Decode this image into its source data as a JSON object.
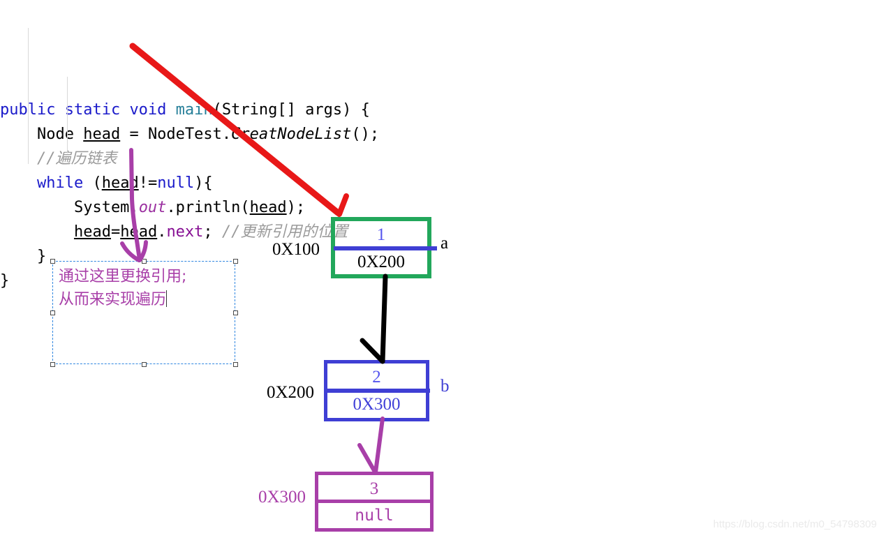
{
  "code": {
    "lines": [
      [
        {
          "t": "public ",
          "c": "kw"
        },
        {
          "t": "static ",
          "c": "kw"
        },
        {
          "t": "void ",
          "c": "kw"
        },
        {
          "t": "main",
          "c": "method"
        },
        {
          "t": "(String[] args) {",
          "c": "plain"
        }
      ],
      [
        {
          "t": "    Node ",
          "c": "plain"
        },
        {
          "t": "head",
          "c": "ident"
        },
        {
          "t": " = NodeTest.",
          "c": "plain"
        },
        {
          "t": "CreatNodeList",
          "c": "ital"
        },
        {
          "t": "();",
          "c": "plain"
        }
      ],
      [
        {
          "t": "    //遍历链表",
          "c": "cmt"
        }
      ],
      [
        {
          "t": "    ",
          "c": "plain"
        },
        {
          "t": "while",
          "c": "kw"
        },
        {
          "t": " (",
          "c": "plain"
        },
        {
          "t": "head",
          "c": "ident"
        },
        {
          "t": "!=",
          "c": "plain"
        },
        {
          "t": "null",
          "c": "kw"
        },
        {
          "t": "){",
          "c": "plain"
        }
      ],
      [
        {
          "t": "        System.",
          "c": "plain"
        },
        {
          "t": "out",
          "c": "field"
        },
        {
          "t": ".println(",
          "c": "plain"
        },
        {
          "t": "head",
          "c": "ident"
        },
        {
          "t": ");",
          "c": "plain"
        }
      ],
      [
        {
          "t": "        ",
          "c": "plain"
        },
        {
          "t": "head",
          "c": "ident"
        },
        {
          "t": "=",
          "c": "plain"
        },
        {
          "t": "head",
          "c": "ident"
        },
        {
          "t": ".",
          "c": "plain"
        },
        {
          "t": "next",
          "c": "prop"
        },
        {
          "t": "; ",
          "c": "plain"
        },
        {
          "t": "//更新引用的位置",
          "c": "cmt"
        }
      ],
      [
        {
          "t": "    }",
          "c": "plain"
        }
      ],
      [
        {
          "t": "}",
          "c": "plain"
        }
      ]
    ]
  },
  "annotation_box": {
    "line1": "通过这里更换引用;",
    "line2": "从而来实现遍历"
  },
  "nodes": [
    {
      "id": "node-1",
      "value": "1",
      "next_addr": "0X200",
      "address_label": "0X100",
      "var_label": "a",
      "border_color": "#22a75b",
      "value_color": "#5555ee",
      "next_color": "#000000",
      "divider_color": "#3f3fd4",
      "address_label_color": "#000000",
      "var_label_color": "#000000"
    },
    {
      "id": "node-2",
      "value": "2",
      "next_addr": "0X300",
      "address_label": "0X200",
      "var_label": "b",
      "border_color": "#3f3fd4",
      "value_color": "#5555ee",
      "next_color": "#4141d8",
      "divider_color": "#3f3fd4",
      "address_label_color": "#000000",
      "var_label_color": "#3f3fd4"
    },
    {
      "id": "node-3",
      "value": "3",
      "next_addr": "null",
      "address_label": "0X300",
      "var_label": "",
      "border_color": "#a83fa8",
      "value_color": "#a83fa8",
      "next_color": "#a83fa8",
      "divider_color": "#a83fa8",
      "address_label_color": "#a83fa8",
      "var_label_color": "#a83fa8"
    }
  ],
  "annotations": {
    "red_arrow_color": "#e81818",
    "purple_arrow_color": "#a83fa8",
    "black_arrow_color": "#000000",
    "selection_border_color": "#2f86e0"
  },
  "watermark": {
    "text": "https://blog.csdn.net/m0_54798309"
  }
}
